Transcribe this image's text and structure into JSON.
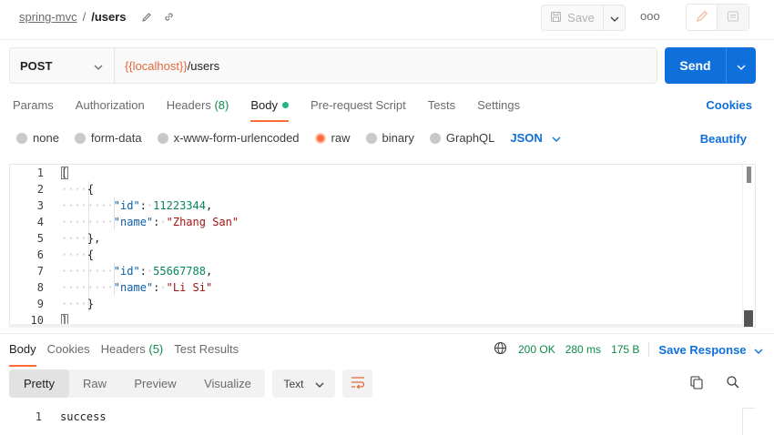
{
  "header": {
    "collection": "spring-mvc",
    "separator": "/",
    "request_name": "/users",
    "save_label": "Save",
    "more_label": "ooo"
  },
  "request": {
    "method": "POST",
    "url_variable": "{{localhost}}",
    "url_path": "/users",
    "send_label": "Send"
  },
  "tabs": [
    {
      "label": "Params"
    },
    {
      "label": "Authorization"
    },
    {
      "label": "Headers",
      "count": "(8)"
    },
    {
      "label": "Body"
    },
    {
      "label": "Pre-request Script"
    },
    {
      "label": "Tests"
    },
    {
      "label": "Settings"
    }
  ],
  "cookies_label": "Cookies",
  "body_options": [
    {
      "label": "none"
    },
    {
      "label": "form-data"
    },
    {
      "label": "x-www-form-urlencoded"
    },
    {
      "label": "raw",
      "selected": true
    },
    {
      "label": "binary"
    },
    {
      "label": "GraphQL"
    }
  ],
  "body_format": "JSON",
  "beautify_label": "Beautify",
  "editor": {
    "line_numbers": [
      "1",
      "2",
      "3",
      "4",
      "5",
      "6",
      "7",
      "8",
      "9",
      "10"
    ],
    "records": [
      {
        "id_key": "\"id\"",
        "id_value": "11223344",
        "name_key": "\"name\"",
        "name_value": "\"Zhang San\""
      },
      {
        "id_key": "\"id\"",
        "id_value": "55667788",
        "name_key": "\"name\"",
        "name_value": "\"Li Si\""
      }
    ],
    "open_bracket": "[",
    "close_bracket": "]",
    "open_brace": "{",
    "close_brace_comma": "},",
    "close_brace": "}"
  },
  "response": {
    "tabs": [
      {
        "label": "Body"
      },
      {
        "label": "Cookies"
      },
      {
        "label": "Headers",
        "count": "(5)"
      },
      {
        "label": "Test Results"
      }
    ],
    "status": "200 OK",
    "time": "280 ms",
    "size": "175 B",
    "save_response_label": "Save Response",
    "view_modes": [
      "Pretty",
      "Raw",
      "Preview",
      "Visualize"
    ],
    "format": "Text",
    "line_number": "1",
    "body_text": "success"
  },
  "colors": {
    "accent": "#ff6c37",
    "primary": "#0f6fdb",
    "success": "#0e8a4a"
  }
}
